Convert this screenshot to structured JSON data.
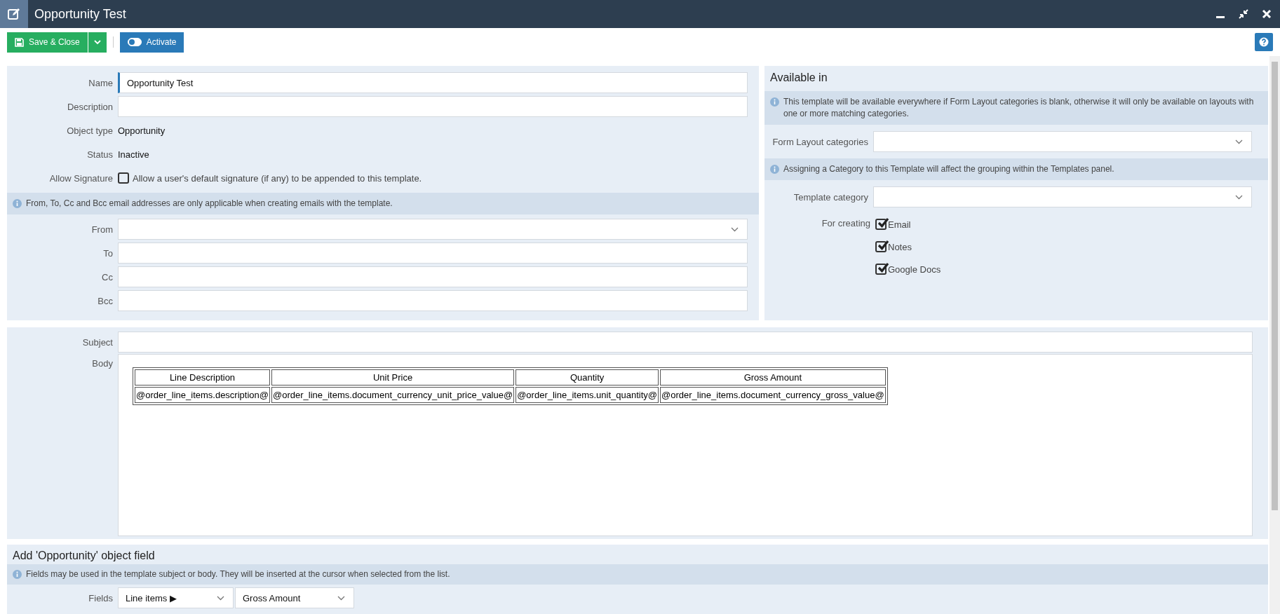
{
  "window": {
    "title": "Opportunity Test"
  },
  "toolbar": {
    "save_button": "Save & Close",
    "activate_button": "Activate",
    "activate_on": false
  },
  "details": {
    "rows": [
      {
        "label": "Name",
        "kind": "input",
        "value": "Opportunity Test",
        "focused": true
      },
      {
        "label": "Description",
        "kind": "input",
        "focused": false
      },
      {
        "label": "Object type",
        "kind": "static",
        "value": "Opportunity"
      },
      {
        "label": "Status",
        "kind": "static",
        "value": "Inactive"
      },
      {
        "label": "Allow Signature",
        "kind": "checkbox",
        "text": "Allow a user's default signature (if any) to be appended to this template.",
        "checked": false
      }
    ],
    "notice": "From, To, Cc and Bcc email addresses are only applicable when creating emails with the template.",
    "email_fields": [
      {
        "label": "From",
        "kind": "select"
      },
      {
        "label": "To",
        "kind": "input"
      },
      {
        "label": "Cc",
        "kind": "input"
      },
      {
        "label": "Bcc",
        "kind": "input"
      }
    ]
  },
  "available_in": {
    "title": "Available in",
    "notice": "This template will be available everywhere if Form Layout categories is blank, otherwise it will only be available on layouts with one or more matching categories.",
    "form_layout_label": "Form Layout categories",
    "category_notice": "Assigning a Category to this Template will affect the grouping within the Templates panel.",
    "template_category_label": "Template category",
    "for_creating_label": "For creating",
    "for_creating": [
      {
        "label": "Email",
        "checked": true
      },
      {
        "label": "Notes",
        "checked": true
      },
      {
        "label": "Google Docs",
        "checked": true
      }
    ]
  },
  "message": {
    "subject_label": "Subject",
    "body_label": "Body",
    "body_table": {
      "columns": [
        "Line Description",
        "Unit Price",
        "Quantity",
        "Gross Amount"
      ],
      "rows": [
        [
          "@order_line_items.description@",
          "@order_line_items.document_currency_unit_price_value@",
          "@order_line_items.unit_quantity@",
          "@order_line_items.document_currency_gross_value@"
        ]
      ]
    }
  },
  "add_field": {
    "title": "Add 'Opportunity' object field",
    "notice": "Fields may be used in the template subject or body. They will be inserted at the cursor when selected from the list.",
    "fields_label": "Fields",
    "selects": [
      "Line items ▶",
      "Gross Amount"
    ]
  }
}
